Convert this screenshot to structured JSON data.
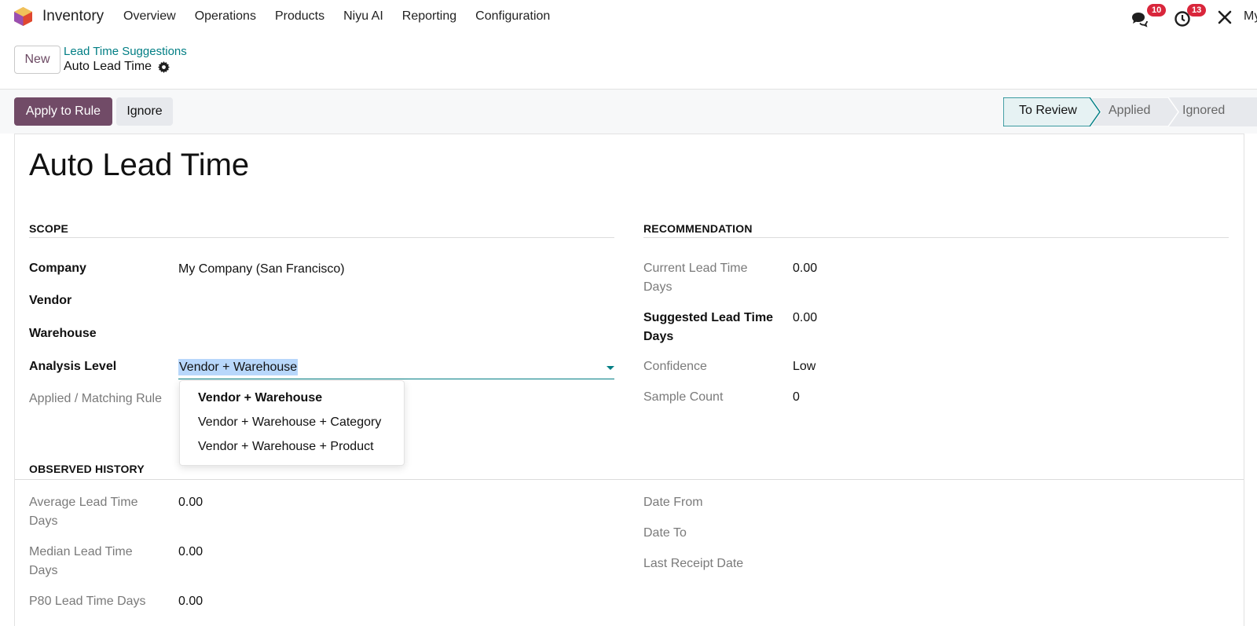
{
  "navbar": {
    "app_name": "Inventory",
    "menu": [
      "Overview",
      "Operations",
      "Products",
      "Niyu AI",
      "Reporting",
      "Configuration"
    ],
    "messages_count": "10",
    "activities_count": "13",
    "user_fragment": "My"
  },
  "control": {
    "new_label": "New",
    "breadcrumb_parent": "Lead Time Suggestions",
    "breadcrumb_current": "Auto Lead Time"
  },
  "actions": {
    "apply_label": "Apply to Rule",
    "ignore_label": "Ignore"
  },
  "statusbar": {
    "stages": [
      "To Review",
      "Applied",
      "Ignored"
    ],
    "active": "To Review"
  },
  "form": {
    "title": "Auto Lead Time",
    "scope": {
      "heading": "SCOPE",
      "company_label": "Company",
      "company_value": "My Company (San Francisco)",
      "vendor_label": "Vendor",
      "warehouse_label": "Warehouse",
      "analysis_label": "Analysis Level",
      "analysis_value": "Vendor + Warehouse",
      "applied_rule_label": "Applied / Matching Rule"
    },
    "analysis_options": [
      "Vendor + Warehouse",
      "Vendor + Warehouse + Category",
      "Vendor + Warehouse + Product"
    ],
    "recommendation": {
      "heading": "RECOMMENDATION",
      "current_label": "Current Lead Time Days",
      "current_value": "0.00",
      "suggested_label": "Suggested Lead Time Days",
      "suggested_value": "0.00",
      "confidence_label": "Confidence",
      "confidence_value": "Low",
      "sample_label": "Sample Count",
      "sample_value": "0"
    },
    "history": {
      "heading": "OBSERVED HISTORY",
      "avg_label": "Average Lead Time Days",
      "avg_value": "0.00",
      "median_label": "Median Lead Time Days",
      "median_value": "0.00",
      "p80_label": "P80 Lead Time Days",
      "p80_value": "0.00",
      "date_from_label": "Date From",
      "date_to_label": "Date To",
      "last_receipt_label": "Last Receipt Date"
    }
  },
  "colors": {
    "primary": "#714b67",
    "accent": "#017e84",
    "badge": "#d9263b"
  }
}
